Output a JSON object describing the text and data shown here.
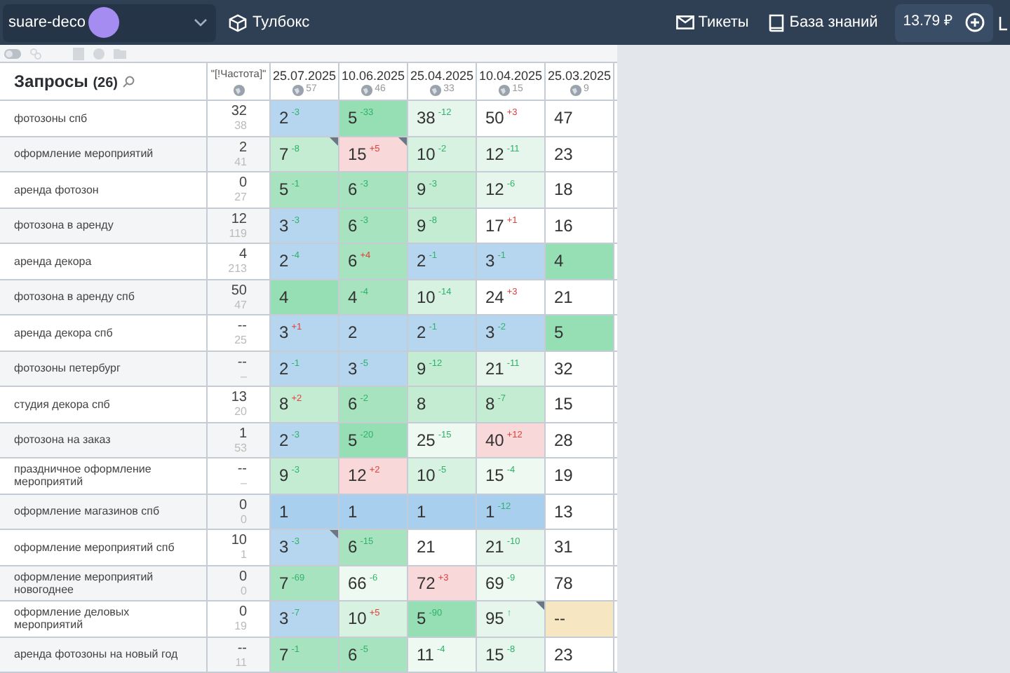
{
  "top_bar": {
    "project": "suare-deco",
    "toolbox": "Тулбокс",
    "tickets": "Тикеты",
    "knowledge_base": "База знаний",
    "balance": "13.79 ₽"
  },
  "table": {
    "title": "Запросы",
    "count": "(26)",
    "freq_header": "\"[!Частота]\"",
    "dates": [
      {
        "label": "25.07.2025",
        "count": "57"
      },
      {
        "label": "10.06.2025",
        "count": "46"
      },
      {
        "label": "25.04.2025",
        "count": "33"
      },
      {
        "label": "10.04.2025",
        "count": "15"
      },
      {
        "label": "25.03.2025",
        "count": "9"
      }
    ],
    "rows": [
      {
        "query": "фотозоны спб",
        "freq": "32",
        "freq_sub": "38",
        "cells": [
          {
            "value": "2",
            "delta": "-3",
            "rise": false,
            "color": "#b6d6f0"
          },
          {
            "value": "5",
            "delta": "-33",
            "rise": false,
            "color": "#96deb3"
          },
          {
            "value": "38",
            "delta": "-12",
            "rise": false,
            "color": "#e6f6ed"
          },
          {
            "value": "50",
            "delta": "+3",
            "rise": true,
            "color": "#ffffff"
          },
          {
            "value": "47",
            "color": "#ffffff"
          }
        ]
      },
      {
        "query": "оформление мероприятий",
        "freq": "2",
        "freq_sub": "41",
        "cells": [
          {
            "value": "7",
            "delta": "-8",
            "rise": false,
            "color": "#c3ecd3",
            "flag": true
          },
          {
            "value": "15",
            "delta": "+5",
            "rise": true,
            "color": "#f9d8da",
            "flag": true
          },
          {
            "value": "10",
            "delta": "-2",
            "rise": false,
            "color": "#d8f2e2"
          },
          {
            "value": "12",
            "delta": "-11",
            "rise": false,
            "color": "#e6f6ed"
          },
          {
            "value": "23",
            "color": "#ffffff"
          }
        ]
      },
      {
        "query": "аренда фотозон",
        "freq": "0",
        "freq_sub": "27",
        "cells": [
          {
            "value": "5",
            "delta": "-1",
            "rise": false,
            "color": "#a6e3be"
          },
          {
            "value": "6",
            "delta": "-3",
            "rise": false,
            "color": "#a6e3be"
          },
          {
            "value": "9",
            "delta": "-3",
            "rise": false,
            "color": "#c3ecd3"
          },
          {
            "value": "12",
            "delta": "-6",
            "rise": false,
            "color": "#e6f6ed"
          },
          {
            "value": "18",
            "color": "#ffffff"
          }
        ]
      },
      {
        "query": "фотозона в аренду",
        "freq": "12",
        "freq_sub": "119",
        "cells": [
          {
            "value": "3",
            "delta": "-3",
            "rise": false,
            "color": "#b6d6f0"
          },
          {
            "value": "6",
            "delta": "-3",
            "rise": false,
            "color": "#a6e3be"
          },
          {
            "value": "9",
            "delta": "-8",
            "rise": false,
            "color": "#c3ecd3"
          },
          {
            "value": "17",
            "delta": "+1",
            "rise": true,
            "color": "#ffffff"
          },
          {
            "value": "16",
            "color": "#ffffff"
          }
        ]
      },
      {
        "query": "аренда декора",
        "freq": "4",
        "freq_sub": "213",
        "cells": [
          {
            "value": "2",
            "delta": "-4",
            "rise": false,
            "color": "#b6d6f0"
          },
          {
            "value": "6",
            "delta": "+4",
            "rise": true,
            "color": "#a6e3be"
          },
          {
            "value": "2",
            "delta": "-1",
            "rise": false,
            "color": "#b6d6f0"
          },
          {
            "value": "3",
            "delta": "-1",
            "rise": false,
            "color": "#b6d6f0"
          },
          {
            "value": "4",
            "color": "#96deb3"
          }
        ]
      },
      {
        "query": "фотозона в аренду спб",
        "freq": "50",
        "freq_sub": "47",
        "cells": [
          {
            "value": "4",
            "color": "#96deb3"
          },
          {
            "value": "4",
            "delta": "-4",
            "rise": false,
            "color": "#a6e3be"
          },
          {
            "value": "10",
            "delta": "-14",
            "rise": false,
            "color": "#d8f2e2"
          },
          {
            "value": "24",
            "delta": "+3",
            "rise": true,
            "color": "#ffffff"
          },
          {
            "value": "21",
            "color": "#ffffff"
          }
        ]
      },
      {
        "query": "аренда декора спб",
        "freq": "--",
        "freq_sub": "25",
        "cells": [
          {
            "value": "3",
            "delta": "+1",
            "rise": true,
            "color": "#b6d6f0"
          },
          {
            "value": "2",
            "color": "#b6d6f0"
          },
          {
            "value": "2",
            "delta": "-1",
            "rise": false,
            "color": "#b6d6f0"
          },
          {
            "value": "3",
            "delta": "-2",
            "rise": false,
            "color": "#b6d6f0"
          },
          {
            "value": "5",
            "color": "#96deb3"
          }
        ]
      },
      {
        "query": "фотозоны петербург",
        "freq": "--",
        "freq_sub": "–",
        "cells": [
          {
            "value": "2",
            "delta": "-1",
            "rise": false,
            "color": "#b6d6f0"
          },
          {
            "value": "3",
            "delta": "-5",
            "rise": false,
            "color": "#b6d6f0"
          },
          {
            "value": "9",
            "delta": "-12",
            "rise": false,
            "color": "#c3ecd3"
          },
          {
            "value": "21",
            "delta": "-11",
            "rise": false,
            "color": "#e6f6ed"
          },
          {
            "value": "32",
            "color": "#ffffff"
          }
        ]
      },
      {
        "query": "студия декора спб",
        "freq": "13",
        "freq_sub": "20",
        "cells": [
          {
            "value": "8",
            "delta": "+2",
            "rise": true,
            "color": "#c3ecd3"
          },
          {
            "value": "6",
            "delta": "-2",
            "rise": false,
            "color": "#a6e3be"
          },
          {
            "value": "8",
            "color": "#c3ecd3"
          },
          {
            "value": "8",
            "delta": "-7",
            "rise": false,
            "color": "#c3ecd3"
          },
          {
            "value": "15",
            "color": "#ffffff"
          }
        ]
      },
      {
        "query": "фотозона на заказ",
        "freq": "1",
        "freq_sub": "53",
        "cells": [
          {
            "value": "2",
            "delta": "-3",
            "rise": false,
            "color": "#b6d6f0"
          },
          {
            "value": "5",
            "delta": "-20",
            "rise": false,
            "color": "#96deb3"
          },
          {
            "value": "25",
            "delta": "-15",
            "rise": false,
            "color": "#eef9f2"
          },
          {
            "value": "40",
            "delta": "+12",
            "rise": true,
            "color": "#f9d8da"
          },
          {
            "value": "28",
            "color": "#ffffff"
          }
        ]
      },
      {
        "query": "праздничное оформление мероприятий",
        "freq": "--",
        "freq_sub": "–",
        "cells": [
          {
            "value": "9",
            "delta": "-3",
            "rise": false,
            "color": "#c3ecd3"
          },
          {
            "value": "12",
            "delta": "+2",
            "rise": true,
            "color": "#f9d8da"
          },
          {
            "value": "10",
            "delta": "-5",
            "rise": false,
            "color": "#d8f2e2"
          },
          {
            "value": "15",
            "delta": "-4",
            "rise": false,
            "color": "#eef9f2"
          },
          {
            "value": "19",
            "color": "#ffffff"
          }
        ]
      },
      {
        "query": "оформление магазинов спб",
        "freq": "0",
        "freq_sub": "0",
        "cells": [
          {
            "value": "1",
            "color": "#a9cfee"
          },
          {
            "value": "1",
            "color": "#a9cfee"
          },
          {
            "value": "1",
            "color": "#a9cfee"
          },
          {
            "value": "1",
            "delta": "-12",
            "rise": false,
            "color": "#a9cfee"
          },
          {
            "value": "13",
            "color": "#ffffff"
          }
        ]
      },
      {
        "query": "оформление мероприятий спб",
        "freq": "10",
        "freq_sub": "1",
        "cells": [
          {
            "value": "3",
            "delta": "-3",
            "rise": false,
            "color": "#b6d6f0",
            "flag": true
          },
          {
            "value": "6",
            "delta": "-15",
            "rise": false,
            "color": "#a6e3be"
          },
          {
            "value": "21",
            "color": "#ffffff"
          },
          {
            "value": "21",
            "delta": "-10",
            "rise": false,
            "color": "#e6f6ed"
          },
          {
            "value": "31",
            "color": "#ffffff"
          }
        ]
      },
      {
        "query": "оформление мероприятий новогоднее",
        "freq": "0",
        "freq_sub": "0",
        "cells": [
          {
            "value": "7",
            "delta": "-69",
            "rise": false,
            "color": "#a6e3be"
          },
          {
            "value": "66",
            "delta": "-6",
            "rise": false,
            "color": "#eef9f2"
          },
          {
            "value": "72",
            "delta": "+3",
            "rise": true,
            "color": "#f9d8da"
          },
          {
            "value": "69",
            "delta": "-9",
            "rise": false,
            "color": "#eef9f2"
          },
          {
            "value": "78",
            "color": "#ffffff"
          }
        ]
      },
      {
        "query": "оформление деловых мероприятий",
        "freq": "0",
        "freq_sub": "19",
        "cells": [
          {
            "value": "3",
            "delta": "-7",
            "rise": false,
            "color": "#b6d6f0"
          },
          {
            "value": "10",
            "delta": "+5",
            "rise": true,
            "color": "#d8f2e2"
          },
          {
            "value": "5",
            "delta": "-90",
            "rise": false,
            "color": "#96deb3"
          },
          {
            "value": "95",
            "delta": "↑",
            "rise": false,
            "color": "#e6f6ed",
            "flag": true
          },
          {
            "value": "--",
            "color": "#f6e6c2"
          }
        ]
      },
      {
        "query": "аренда фотозоны на новый год",
        "freq": "--",
        "freq_sub": "11",
        "cells": [
          {
            "value": "7",
            "delta": "-1",
            "rise": false,
            "color": "#a6e3be"
          },
          {
            "value": "6",
            "delta": "-5",
            "rise": false,
            "color": "#a6e3be"
          },
          {
            "value": "11",
            "delta": "-4",
            "rise": false,
            "color": "#eef9f2"
          },
          {
            "value": "15",
            "delta": "-8",
            "rise": false,
            "color": "#e6f6ed"
          },
          {
            "value": "23",
            "color": "#ffffff"
          }
        ]
      }
    ]
  }
}
